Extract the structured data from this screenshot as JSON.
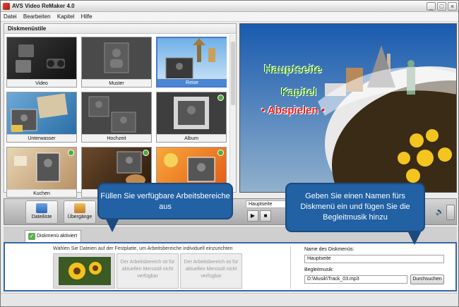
{
  "window": {
    "title": "AVS Video ReMaker 4.0"
  },
  "menu": {
    "items": [
      "Datei",
      "Bearbeiten",
      "Kapitel",
      "Hilfe"
    ]
  },
  "panel": {
    "title": "Diskmenüstile",
    "thumbs": [
      {
        "label": "Video"
      },
      {
        "label": "Muster"
      },
      {
        "label": "Reise"
      },
      {
        "label": "Unterwasser"
      },
      {
        "label": "Hochzeit"
      },
      {
        "label": "Album"
      },
      {
        "label": "Kuchen"
      },
      {
        "label": ""
      },
      {
        "label": ""
      }
    ]
  },
  "preview": {
    "title": "Hauptseite",
    "item1": "Kapitel",
    "item2": "• Abspielen •"
  },
  "toolbar": {
    "btn_dateiliste": "Dateiliste",
    "btn_uebergaenge": "Übergänge",
    "tab": "Hauptseite",
    "play": "▶",
    "stop": "■",
    "volume": "🔊"
  },
  "tabs": {
    "active": "Diskmenü aktiviert"
  },
  "bottom": {
    "hint": "Wählen Sie Dateien auf der Festplatte, um Arbeitsbereiche individuell einzurichten",
    "slot_unavailable": "Der Arbeitsbereich ist für aktuellen Menüstil nicht verfügbar",
    "name_label": "Name des Diskmenüs:",
    "name_value": "Hauptseite",
    "music_label": "Begleitmusik:",
    "music_value": "D:\\Musik\\Track_03.mp3",
    "browse": "Durchsuchen"
  },
  "callouts": {
    "left": "Füllen Sie verfügbare Arbeitsbereiche aus",
    "right": "Geben Sie einen Namen fürs Diskmenü ein und fügen Sie die Begleitmusik hinzu"
  },
  "colors": {
    "accent": "#2161a4",
    "selected": "#4a86d6",
    "title_green": "#2f8d23",
    "play_red": "#e12222"
  }
}
